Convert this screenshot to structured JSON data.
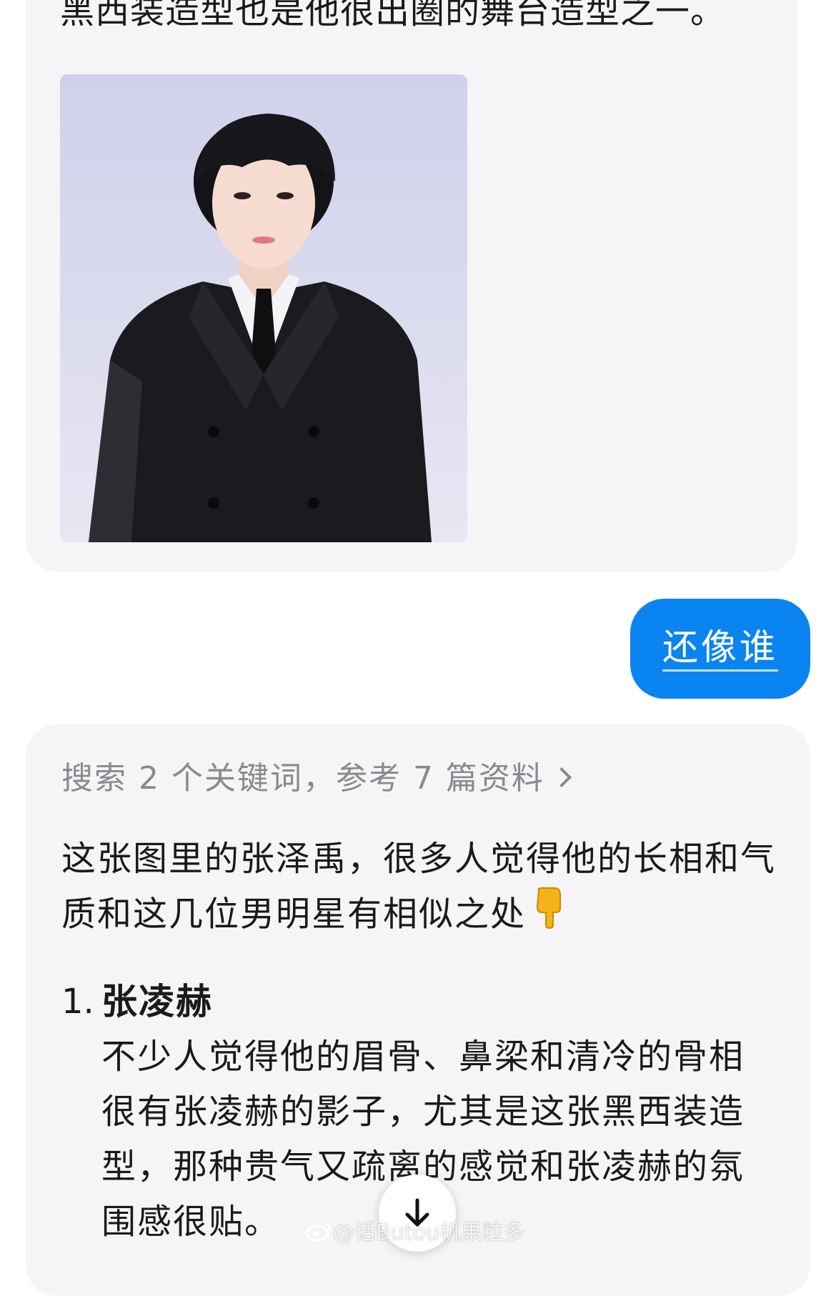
{
  "top_message": {
    "tail_text": "黑西装造型也是他很出圈的舞台造型之一。"
  },
  "user_message": {
    "text": "还像谁"
  },
  "ai_message": {
    "search_summary": "搜索 2 个关键词，参考 7 篇资料",
    "intro": "这张图里的张泽禹，很多人觉得他的长相和气质和这几位男明星有相似之处",
    "items": [
      {
        "number": "1.",
        "name": "张凌赫",
        "description": "不少人觉得他的眉骨、鼻梁和清冷的骨相很有张凌赫的影子，尤其是这张黑西装造型，那种贵气又疏离的感觉和张凌赫的氛围感很贴。"
      }
    ]
  },
  "icons": {
    "pointing_emoji": "backhand-index-pointing-down",
    "scroll": "arrow-down-icon",
    "watermark_logo": "weibo-icon"
  },
  "watermark": {
    "text": "@话Butou机果粒多"
  }
}
